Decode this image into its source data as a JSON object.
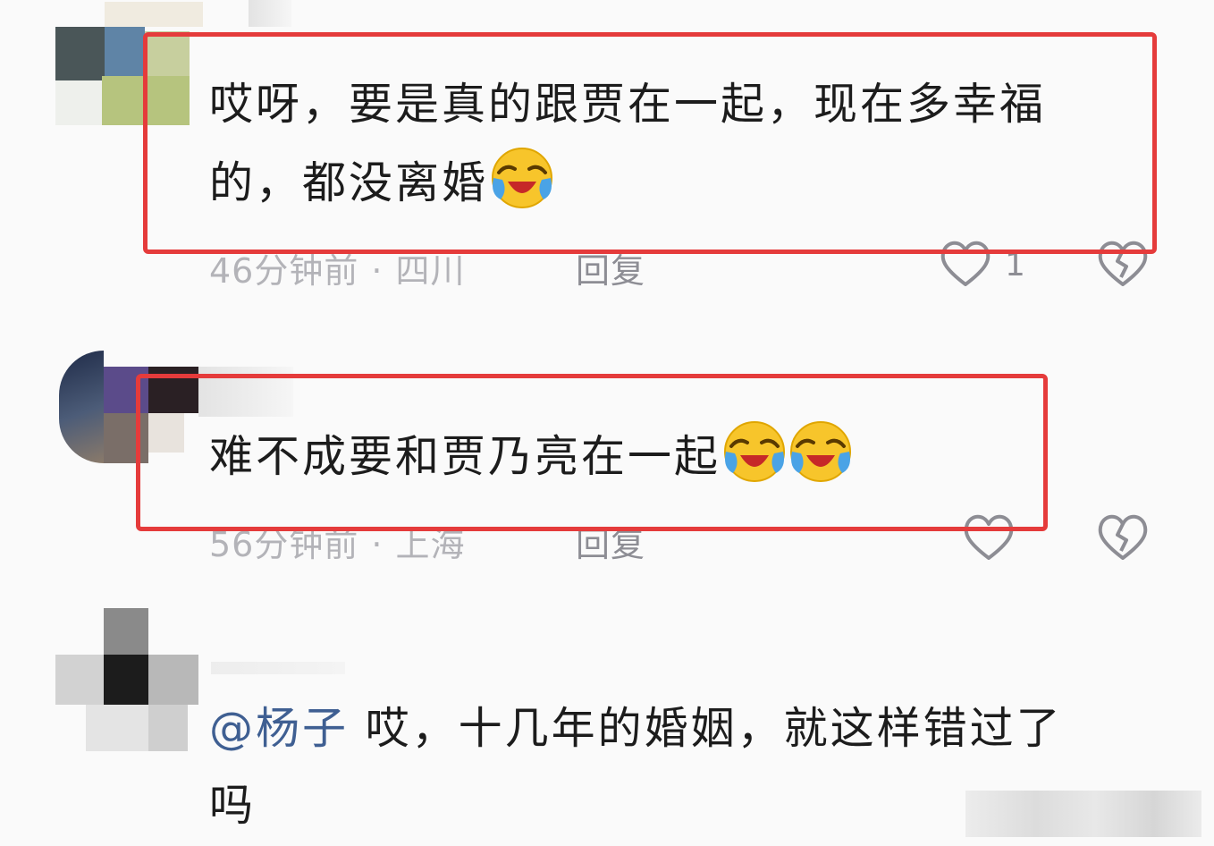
{
  "comments": [
    {
      "text_line1": "哎呀，要是真的跟贾在一起，现在多幸福",
      "text_line2": "的，都没离婚",
      "emoji_count": 1,
      "emoji_icon": "laughing-crying-emoji",
      "time": "46分钟前",
      "location": "四川",
      "reply_label": "回复",
      "like_count": "1",
      "highlighted": true
    },
    {
      "text_line1": "难不成要和贾乃亮在一起",
      "emoji_count": 2,
      "emoji_icon": "laughing-crying-emoji",
      "time": "56分钟前",
      "location": "上海",
      "reply_label": "回复",
      "like_count": "",
      "highlighted": true
    },
    {
      "mention": "@杨子",
      "text_line1": " 哎，十几年的婚姻，就这样错过了",
      "text_line2": "吗",
      "highlighted": false
    }
  ],
  "meta_separator": "·",
  "colors": {
    "highlight_border": "#e53b3b",
    "mention": "#3f5f92",
    "meta_text": "#b3b3b8",
    "emoji_face": "#f7c52b",
    "emoji_tears": "#4aa3e6"
  }
}
